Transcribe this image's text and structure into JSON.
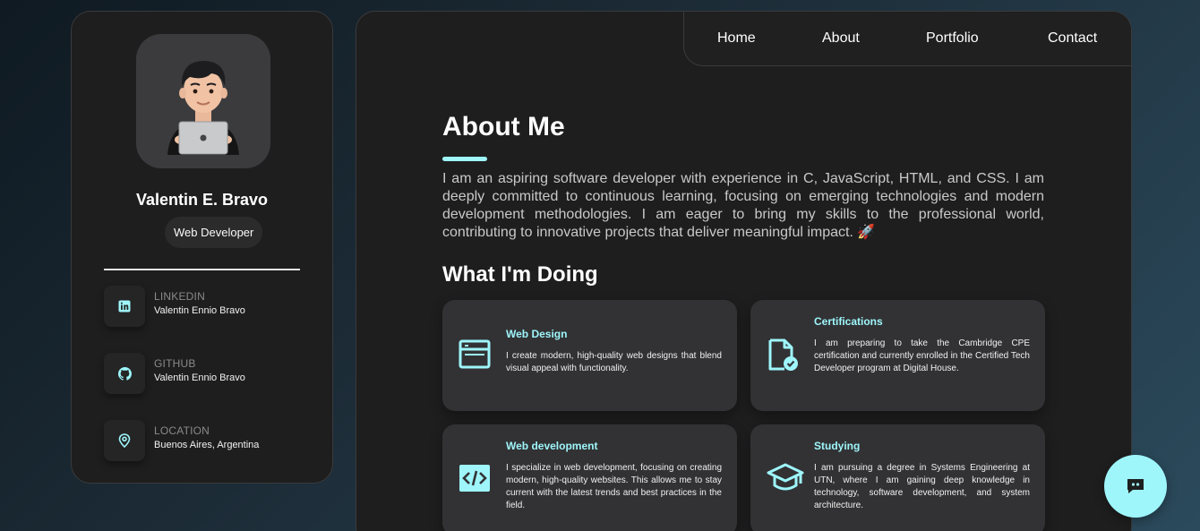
{
  "profile": {
    "name": "Valentin E. Bravo",
    "title": "Web Developer",
    "contacts": [
      {
        "label": "LINKEDIN",
        "value": "Valentin Ennio Bravo",
        "icon": "linkedin-icon"
      },
      {
        "label": "GITHUB",
        "value": "Valentin Ennio Bravo",
        "icon": "github-icon"
      },
      {
        "label": "LOCATION",
        "value": "Buenos Aires, Argentina",
        "icon": "location-pin-icon"
      }
    ]
  },
  "nav": {
    "items": [
      "Home",
      "About",
      "Portfolio",
      "Contact"
    ]
  },
  "about": {
    "title": "About Me",
    "text": "I am an aspiring software developer with experience in C, JavaScript, HTML, and CSS. I am deeply committed to continuous learning, focusing on emerging technologies and modern development methodologies. I am eager to bring my skills to the professional world, contributing to innovative projects that deliver meaningful impact. 🚀"
  },
  "doing": {
    "title": "What I'm Doing",
    "cards": [
      {
        "title": "Web Design",
        "desc": "I create modern, high-quality web designs that blend visual appeal with functionality.",
        "icon": "browser-window-icon"
      },
      {
        "title": "Certifications",
        "desc": "I am preparing to take the Cambridge CPE certification and currently enrolled in the Certified Tech Developer program at Digital House.",
        "icon": "certificate-icon"
      },
      {
        "title": "Web development",
        "desc": "I specialize in web development, focusing on creating modern, high-quality websites. This allows me to stay current with the latest trends and best practices in the field.",
        "icon": "code-icon"
      },
      {
        "title": "Studying",
        "desc": "I am pursuing a degree in Systems Engineering at UTN, where I am gaining deep knowledge in technology, software development, and system architecture.",
        "icon": "graduation-cap-icon"
      }
    ]
  },
  "colors": {
    "accent": "#9ef6fb",
    "card_bg": "#1e1e1f",
    "inner_card_bg": "#323234"
  }
}
